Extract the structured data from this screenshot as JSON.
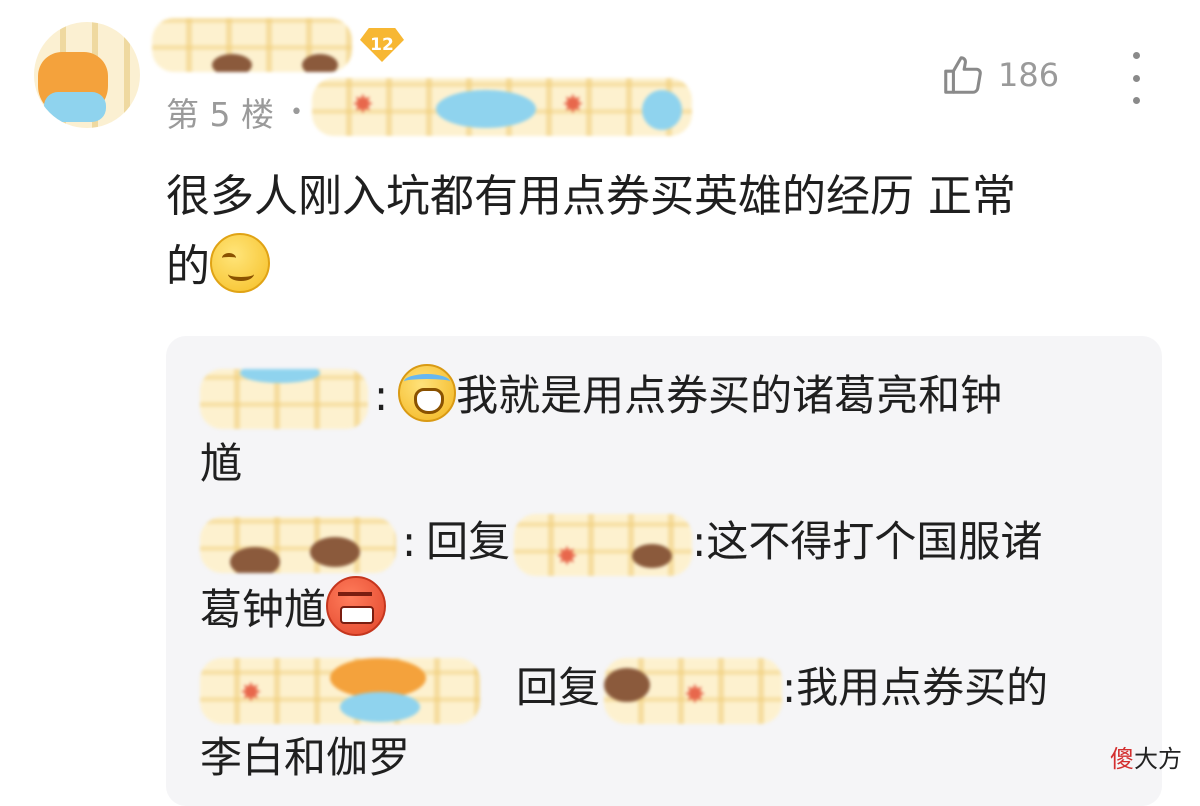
{
  "post": {
    "level": "12",
    "floor": "第 5 楼",
    "floor_separator": "•",
    "like_count": "186",
    "comment_line1": "很多人刚入坑都有用点券买英雄的经历 正常",
    "comment_line2": "的"
  },
  "replies": [
    {
      "colon": ":",
      "line1": "我就是用点券买的诸葛亮和钟",
      "line2": "馗"
    },
    {
      "colon": ":",
      "reply_word": "回复",
      "colon2": ":",
      "line1": "这不得打个国服诸",
      "line2": "葛钟馗"
    },
    {
      "reply_word": "回复",
      "colon2": ":",
      "line1": "我用点券买的",
      "line2": "李白和伽罗"
    }
  ],
  "icons": {
    "like": "thumbs-up-icon",
    "more": "more-vertical-icon",
    "emoji_post": "smirk-emoji-icon",
    "emoji_reply1": "crying-emoji-icon",
    "emoji_reply2": "angry-emoji-icon"
  },
  "watermark": {
    "red_char": "傻",
    "rest": "大方"
  },
  "colors": {
    "level_badge": "#f7b733",
    "meta_text": "#9a9a9a",
    "reply_bg": "#f5f5f7"
  }
}
